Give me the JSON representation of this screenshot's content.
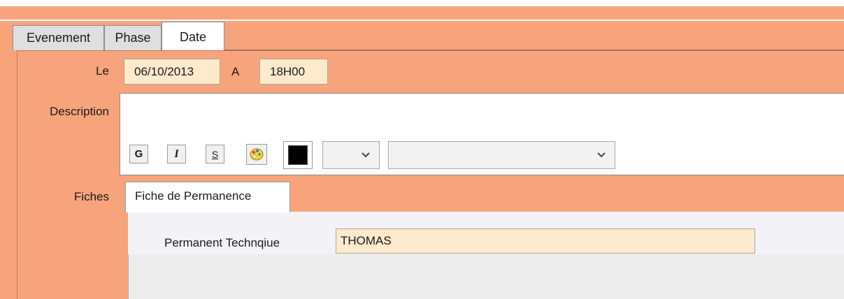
{
  "tabs": [
    {
      "label": "Evenement",
      "active": false
    },
    {
      "label": "Phase",
      "active": false
    },
    {
      "label": "Date",
      "active": true
    }
  ],
  "date_row": {
    "le_label": "Le",
    "date_value": "06/10/2013",
    "a_label": "A",
    "time_value": "18H00"
  },
  "description": {
    "label": "Description",
    "value": "",
    "toolbar": {
      "bold_label": "G",
      "italic_label": "I",
      "strike_label": "S",
      "palette_icon": "palette-icon",
      "text_color": "#000000",
      "font_size_value": "",
      "font_family_value": ""
    }
  },
  "fiches": {
    "label": "Fiches",
    "tab_label": "Fiche de Permanence",
    "field_label": "Permanent Technqiue",
    "field_value": "THOMAS"
  },
  "colors": {
    "frame": "#f7a47c",
    "field_bg": "#fde9cc",
    "panel_bg": "#ececec"
  }
}
